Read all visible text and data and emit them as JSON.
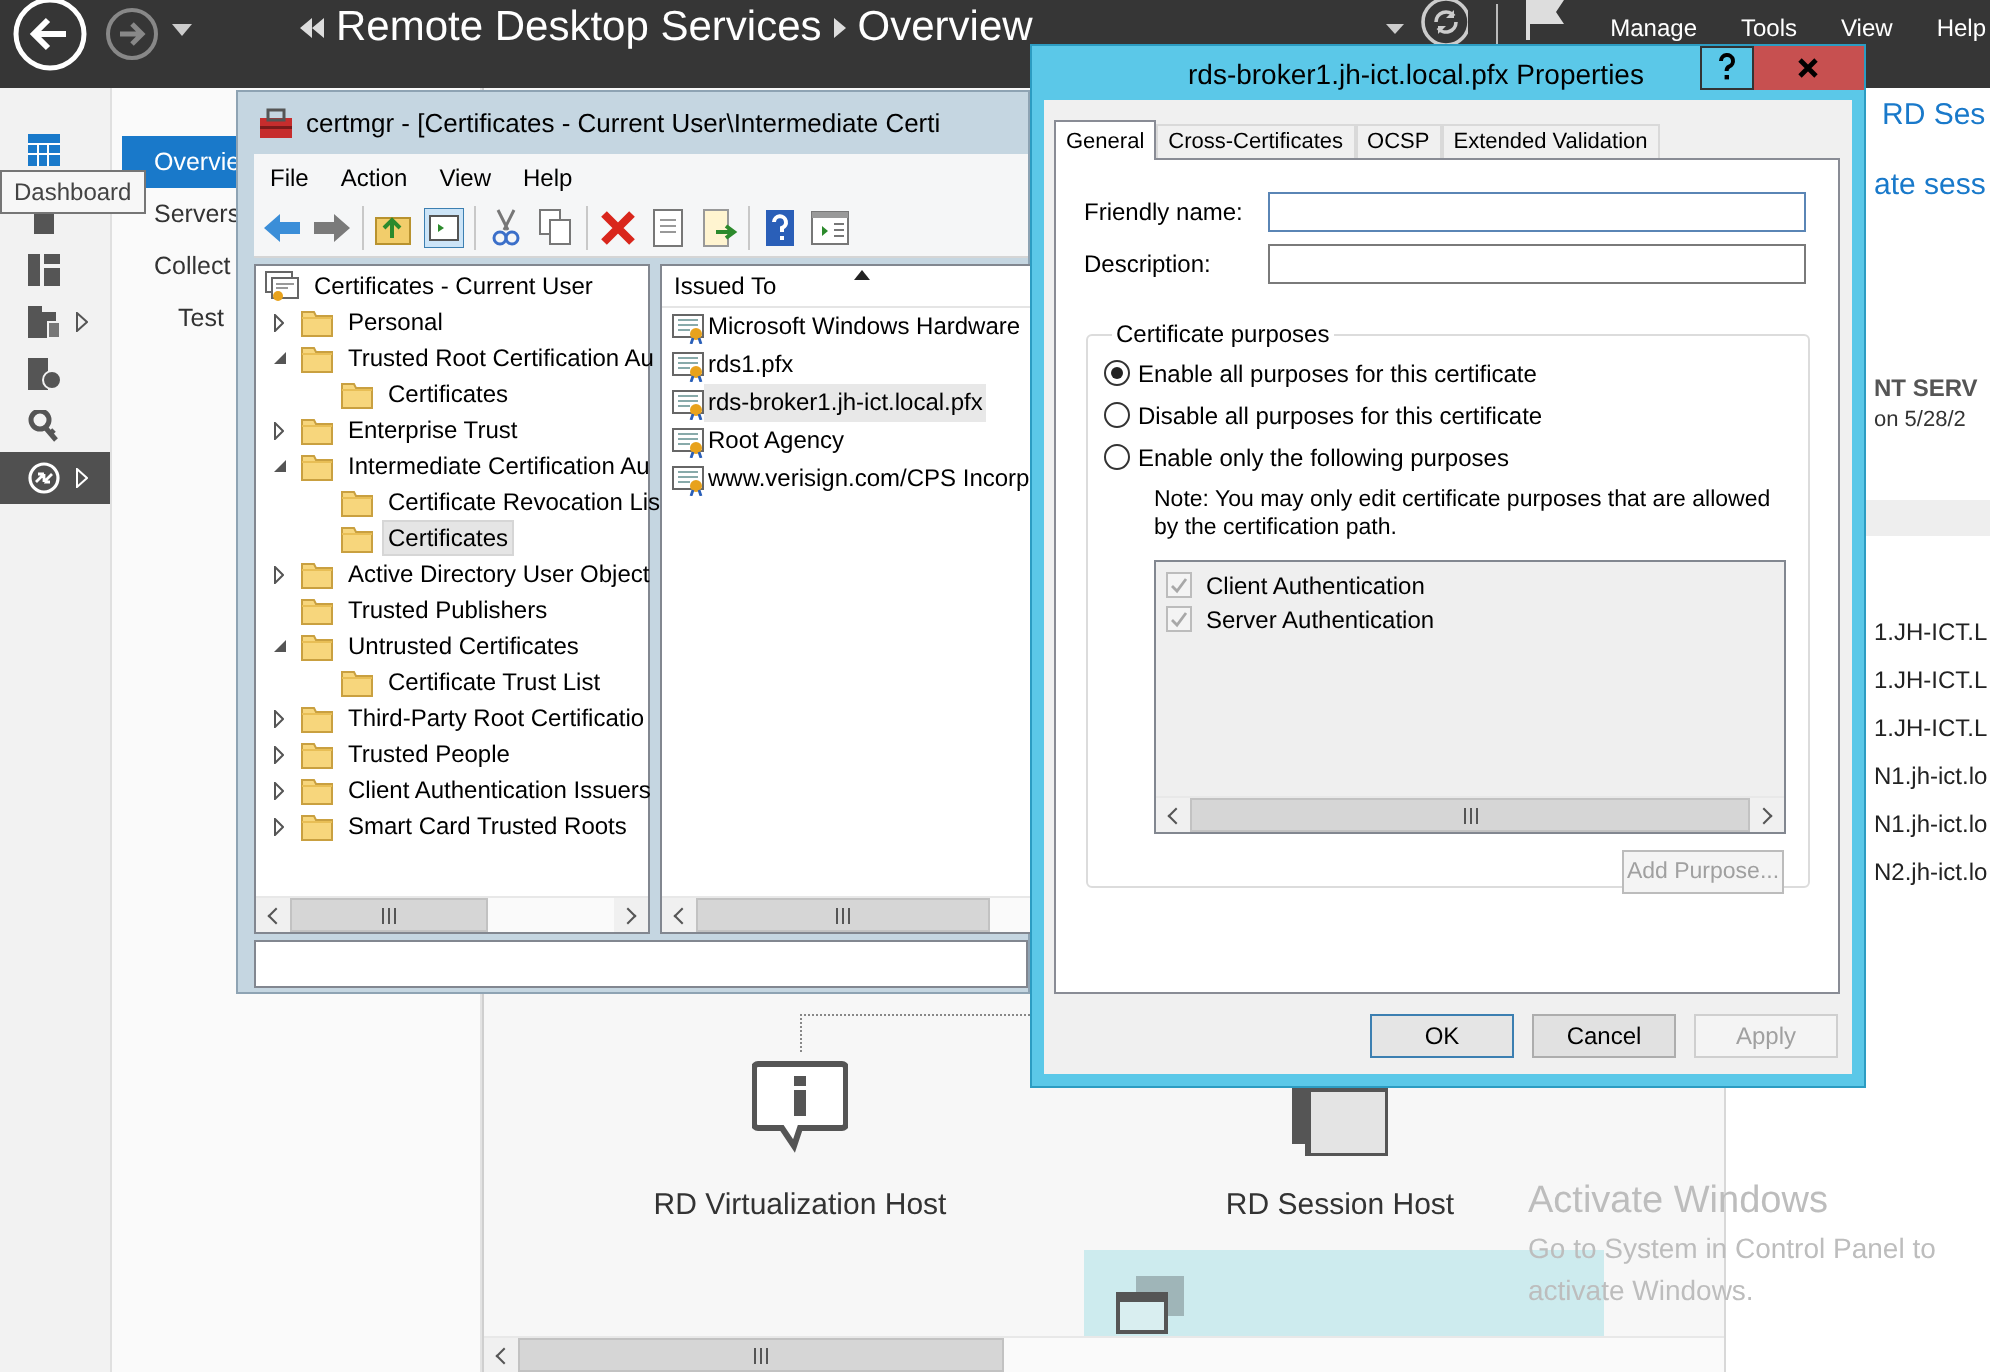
{
  "server_manager": {
    "breadcrumb": [
      "Remote Desktop Services",
      "Overview"
    ],
    "menu": [
      "Manage",
      "Tools",
      "View",
      "Help"
    ],
    "sidebar_icons": [
      {
        "kind": "dashboard",
        "selected": false,
        "flyout": false
      },
      {
        "kind": "local_server",
        "selected": false,
        "flyout": false
      },
      {
        "kind": "all_servers",
        "selected": false,
        "flyout": false
      },
      {
        "kind": "file_services",
        "selected": false,
        "flyout": true
      },
      {
        "kind": "iis",
        "selected": false,
        "flyout": false
      },
      {
        "kind": "tools",
        "selected": false,
        "flyout": false
      },
      {
        "kind": "remote_desktop",
        "selected": true,
        "flyout": true
      }
    ],
    "tooltip": "Dashboard",
    "nav": [
      {
        "label": "Overvie",
        "selected": true
      },
      {
        "label": "Servers",
        "selected": false
      },
      {
        "label": "Collect",
        "selected": false,
        "children": [
          {
            "label": "Test",
            "selected": false
          }
        ]
      }
    ],
    "side_panel": {
      "title": "RD Ses",
      "link": "ate sess",
      "section_title": "NT SERV",
      "section_subtitle": "on 5/28/2",
      "rows": [
        "1.JH-ICT.L",
        "1.JH-ICT.L",
        "1.JH-ICT.L",
        "N1.jh-ict.lo",
        "N1.jh-ict.lo",
        "N2.jh-ict.lo"
      ]
    },
    "roles": [
      {
        "kind": "virtualization",
        "label": "RD Virtualization Host"
      },
      {
        "kind": "session",
        "label": "RD Session Host"
      }
    ]
  },
  "certmgr": {
    "title": "certmgr - [Certificates - Current User\\Intermediate Certi",
    "menu": [
      "File",
      "Action",
      "View",
      "Help"
    ],
    "tree": {
      "label": "Certificates - Current User",
      "children": [
        {
          "label": "Personal",
          "expandable": true,
          "expanded": false,
          "selected": false
        },
        {
          "label": "Trusted Root Certification Au",
          "expandable": true,
          "expanded": true,
          "selected": false,
          "children": [
            {
              "label": "Certificates",
              "expandable": false,
              "selected": false
            }
          ]
        },
        {
          "label": "Enterprise Trust",
          "expandable": true,
          "expanded": false,
          "selected": false
        },
        {
          "label": "Intermediate Certification Au",
          "expandable": true,
          "expanded": true,
          "selected": false,
          "children": [
            {
              "label": "Certificate Revocation Lis",
              "expandable": false,
              "selected": false
            },
            {
              "label": "Certificates",
              "expandable": false,
              "selected": true
            }
          ]
        },
        {
          "label": "Active Directory User Object",
          "expandable": true,
          "expanded": false,
          "selected": false
        },
        {
          "label": "Trusted Publishers",
          "expandable": false,
          "selected": false
        },
        {
          "label": "Untrusted Certificates",
          "expandable": true,
          "expanded": true,
          "selected": false,
          "children": [
            {
              "label": "Certificate Trust List",
              "expandable": false,
              "selected": false
            }
          ]
        },
        {
          "label": "Third-Party Root Certificatio",
          "expandable": true,
          "expanded": false,
          "selected": false
        },
        {
          "label": "Trusted People",
          "expandable": true,
          "expanded": false,
          "selected": false
        },
        {
          "label": "Client Authentication Issuers",
          "expandable": true,
          "expanded": false,
          "selected": false
        },
        {
          "label": "Smart Card Trusted Roots",
          "expandable": true,
          "expanded": false,
          "selected": false
        }
      ]
    },
    "list": {
      "columns": [
        "Issued To"
      ],
      "rows": [
        {
          "label": "Microsoft Windows Hardware",
          "selected": false
        },
        {
          "label": "rds1.pfx",
          "selected": false
        },
        {
          "label": "rds-broker1.jh-ict.local.pfx",
          "selected": true
        },
        {
          "label": "Root Agency",
          "selected": false
        },
        {
          "label": "www.verisign.com/CPS Incorp",
          "selected": false
        }
      ]
    }
  },
  "properties": {
    "title": "rds-broker1.jh-ict.local.pfx Properties",
    "tabs": [
      {
        "label": "General",
        "selected": true
      },
      {
        "label": "Cross-Certificates",
        "selected": false
      },
      {
        "label": "OCSP",
        "selected": false
      },
      {
        "label": "Extended Validation",
        "selected": false
      }
    ],
    "fields": [
      {
        "label": "Friendly name:",
        "focused": true
      },
      {
        "label": "Description:",
        "focused": false
      }
    ],
    "group_title": "Certificate purposes",
    "radios": [
      {
        "label": "Enable all purposes for this certificate",
        "selected": true
      },
      {
        "label": "Disable all purposes for this certificate",
        "selected": false
      },
      {
        "label": "Enable only the following purposes",
        "selected": false
      }
    ],
    "note": "Note: You may only edit certificate purposes that are allowed by the certification path.",
    "purposes": [
      {
        "label": "Client Authentication",
        "checked": true,
        "disabled": true
      },
      {
        "label": "Server Authentication",
        "checked": true,
        "disabled": true
      }
    ],
    "add_button": {
      "label": "Add Purpose...",
      "disabled": true
    },
    "buttons": [
      {
        "label": "OK",
        "default": true,
        "disabled": false
      },
      {
        "label": "Cancel",
        "default": false,
        "disabled": false
      },
      {
        "label": "Apply",
        "default": false,
        "disabled": true
      }
    ]
  },
  "activation_notice": {
    "title": "Activate Windows",
    "message": "Go to System in Control Panel to activate Windows."
  }
}
